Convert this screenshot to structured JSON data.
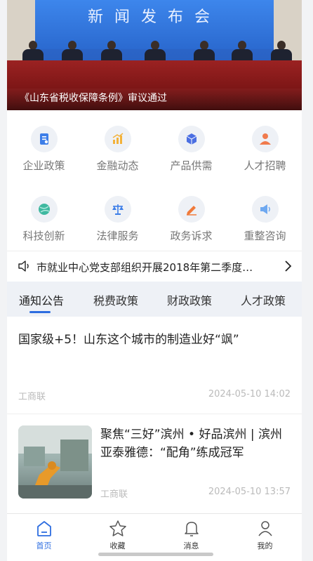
{
  "banner": {
    "backdrop_text": "新闻发布会",
    "caption": "《山东省税收保障条例》审议通过"
  },
  "grid": [
    {
      "label": "企业政策",
      "icon": "document-icon",
      "color": "#3d7ee8"
    },
    {
      "label": "金融动态",
      "icon": "bar-chart-icon",
      "color": "#f3b23a"
    },
    {
      "label": "产品供需",
      "icon": "cube-icon",
      "color": "#4b6fe2"
    },
    {
      "label": "人才招聘",
      "icon": "person-icon",
      "color": "#f07a4c"
    },
    {
      "label": "科技创新",
      "icon": "globe-icon",
      "color": "#3fb8a0"
    },
    {
      "label": "法律服务",
      "icon": "scales-icon",
      "color": "#3d7ee8"
    },
    {
      "label": "政务诉求",
      "icon": "pen-icon",
      "color": "#f07a3a"
    },
    {
      "label": "重整咨询",
      "icon": "megaphone-icon",
      "color": "#6ea8f0"
    }
  ],
  "marquee": {
    "text": "市就业中心党支部组织开展2018年第二季度…"
  },
  "tabs": [
    "通知公告",
    "税费政策",
    "财政政策",
    "人才政策"
  ],
  "news": [
    {
      "title": "国家级+5！山东这个城市的制造业好“飒”",
      "source": "工商联",
      "time": "2024-05-10 14:02"
    },
    {
      "title": "聚焦“三好”滨州 • 好品滨州 | 滨州亚泰雅德：“配角”练成冠军",
      "source": "工商联",
      "time": "2024-05-10 13:57"
    }
  ],
  "bottom_nav": [
    {
      "label": "首页",
      "icon": "home-icon",
      "active": true
    },
    {
      "label": "收藏",
      "icon": "star-icon",
      "active": false
    },
    {
      "label": "消息",
      "icon": "bell-icon",
      "active": false
    },
    {
      "label": "我的",
      "icon": "user-icon",
      "active": false
    }
  ],
  "colors": {
    "accent": "#2d6de0"
  }
}
